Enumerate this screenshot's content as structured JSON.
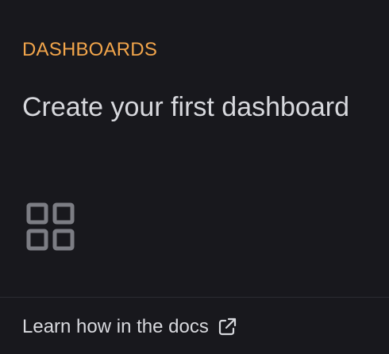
{
  "section_label": "DASHBOARDS",
  "heading": "Create your first dashboard",
  "icons": {
    "main": "dashboard-grid-icon",
    "link": "external-link-icon"
  },
  "footer": {
    "link_label": "Learn how in the docs"
  },
  "colors": {
    "background": "#18181d",
    "accent": "#f2a54b",
    "text": "#d8d9de",
    "icon": "#7c7d84",
    "divider": "#2b2c32"
  }
}
